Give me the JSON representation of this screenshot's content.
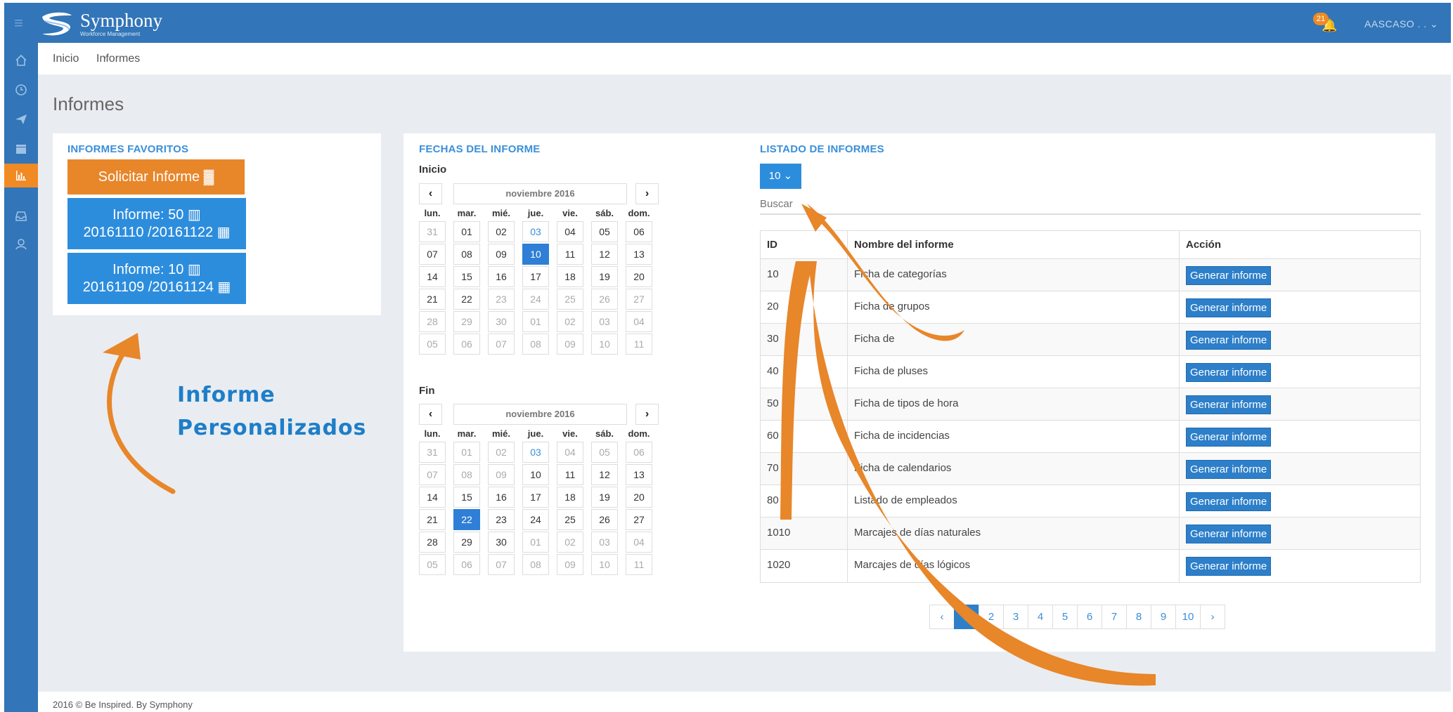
{
  "brand": {
    "name": "Symphony",
    "subtitle": "Workforce Management"
  },
  "header": {
    "notification_count": "21",
    "user_label": "AASCASO . . ⌄"
  },
  "breadcrumb": {
    "home": "Inicio",
    "current": "Informes"
  },
  "page": {
    "title": "Informes"
  },
  "favorites": {
    "title": "INFORMES FAVORITOS",
    "request_button": "Solicitar Informe",
    "items": [
      {
        "line1": "Informe: 50",
        "line2": "20161110 /20161122"
      },
      {
        "line1": "Informe: 10",
        "line2": "20161109 /20161124"
      }
    ]
  },
  "dates": {
    "title": "FECHAS DEL INFORME",
    "dow": [
      "lun.",
      "mar.",
      "mié.",
      "jue.",
      "vie.",
      "sáb.",
      "dom."
    ],
    "start": {
      "label": "Inicio",
      "month": "noviembre 2016",
      "days": [
        "31",
        "01",
        "02",
        "03",
        "04",
        "05",
        "06",
        "07",
        "08",
        "09",
        "10",
        "11",
        "12",
        "13",
        "14",
        "15",
        "16",
        "17",
        "18",
        "19",
        "20",
        "21",
        "22",
        "23",
        "24",
        "25",
        "26",
        "27",
        "28",
        "29",
        "30",
        "01",
        "02",
        "03",
        "04",
        "05",
        "06",
        "07",
        "08",
        "09",
        "10",
        "11"
      ],
      "selected": "10"
    },
    "end": {
      "label": "Fin",
      "month": "noviembre 2016",
      "days": [
        "31",
        "01",
        "02",
        "03",
        "04",
        "05",
        "06",
        "07",
        "08",
        "09",
        "10",
        "11",
        "12",
        "13",
        "14",
        "15",
        "16",
        "17",
        "18",
        "19",
        "20",
        "21",
        "22",
        "23",
        "24",
        "25",
        "26",
        "27",
        "28",
        "29",
        "30",
        "01",
        "02",
        "03",
        "04",
        "05",
        "06",
        "07",
        "08",
        "09",
        "10",
        "11"
      ],
      "selected": "22"
    }
  },
  "listado": {
    "title": "LISTADO DE INFORMES",
    "page_size": "10 ⌄",
    "search_placeholder": "Buscar",
    "columns": [
      "ID",
      "Nombre del informe",
      "Acción"
    ],
    "action_label": "Generar informe",
    "rows": [
      {
        "id": "10",
        "name": "Ficha de categorías"
      },
      {
        "id": "20",
        "name": "Ficha de grupos"
      },
      {
        "id": "30",
        "name": "Ficha de"
      },
      {
        "id": "40",
        "name": "Ficha de pluses"
      },
      {
        "id": "50",
        "name": "Ficha de tipos de hora"
      },
      {
        "id": "60",
        "name": "Ficha de incidencias"
      },
      {
        "id": "70",
        "name": "Ficha de calendarios"
      },
      {
        "id": "80",
        "name": "Listado de empleados"
      },
      {
        "id": "1010",
        "name": "Marcajes de días naturales"
      },
      {
        "id": "1020",
        "name": "Marcajes de días lógicos"
      }
    ],
    "pagination": [
      "‹",
      "1",
      "2",
      "3",
      "4",
      "5",
      "6",
      "7",
      "8",
      "9",
      "10",
      "›"
    ],
    "current_page": "1"
  },
  "annotation": {
    "line1": "Informe",
    "line2": "Personalizados",
    "color": "#e8862a"
  },
  "footer": {
    "text": "2016 © Be Inspired. By Symphony"
  },
  "colors": {
    "primary": "#3275b8",
    "accent": "#e8862a",
    "button": "#2d8ddd"
  }
}
